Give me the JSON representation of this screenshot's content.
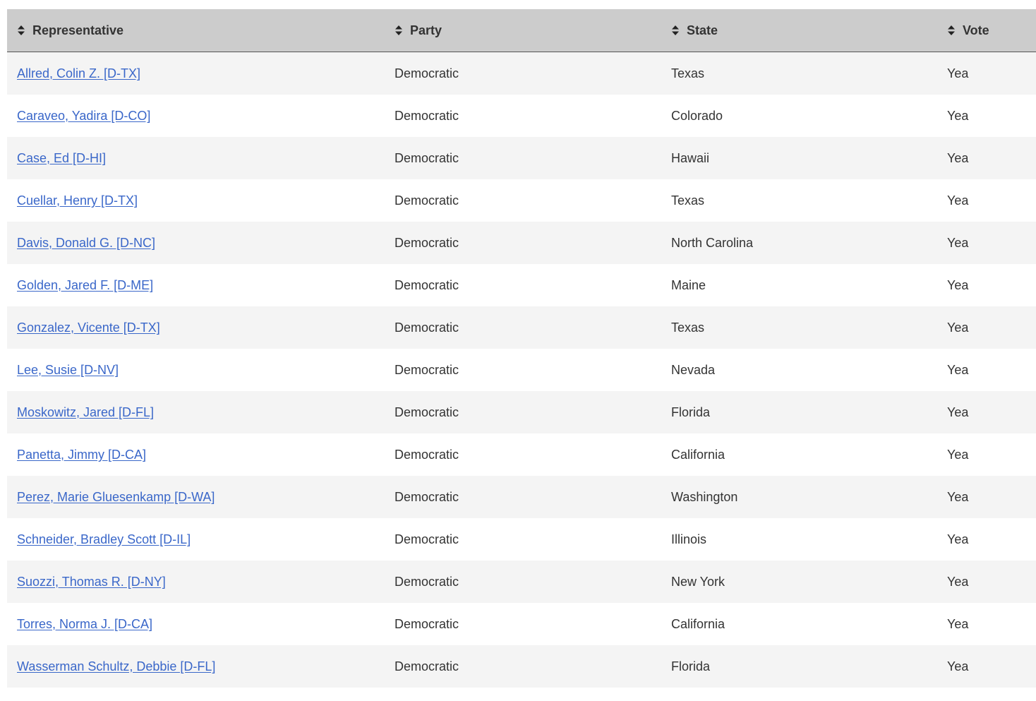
{
  "table": {
    "headers": [
      "Representative",
      "Party",
      "State",
      "Vote"
    ],
    "rows": [
      {
        "representative": "Allred, Colin Z. [D-TX]",
        "party": "Democratic",
        "state": "Texas",
        "vote": "Yea"
      },
      {
        "representative": "Caraveo, Yadira [D-CO]",
        "party": "Democratic",
        "state": "Colorado",
        "vote": "Yea"
      },
      {
        "representative": "Case, Ed [D-HI]",
        "party": "Democratic",
        "state": "Hawaii",
        "vote": "Yea"
      },
      {
        "representative": "Cuellar, Henry [D-TX]",
        "party": "Democratic",
        "state": "Texas",
        "vote": "Yea"
      },
      {
        "representative": "Davis, Donald G. [D-NC]",
        "party": "Democratic",
        "state": "North Carolina",
        "vote": "Yea"
      },
      {
        "representative": "Golden, Jared F. [D-ME]",
        "party": "Democratic",
        "state": "Maine",
        "vote": "Yea"
      },
      {
        "representative": "Gonzalez, Vicente [D-TX]",
        "party": "Democratic",
        "state": "Texas",
        "vote": "Yea"
      },
      {
        "representative": "Lee, Susie [D-NV]",
        "party": "Democratic",
        "state": "Nevada",
        "vote": "Yea"
      },
      {
        "representative": "Moskowitz, Jared [D-FL]",
        "party": "Democratic",
        "state": "Florida",
        "vote": "Yea"
      },
      {
        "representative": "Panetta, Jimmy [D-CA]",
        "party": "Democratic",
        "state": "California",
        "vote": "Yea"
      },
      {
        "representative": "Perez, Marie Gluesenkamp [D-WA]",
        "party": "Democratic",
        "state": "Washington",
        "vote": "Yea"
      },
      {
        "representative": "Schneider, Bradley Scott [D-IL]",
        "party": "Democratic",
        "state": "Illinois",
        "vote": "Yea"
      },
      {
        "representative": "Suozzi, Thomas R. [D-NY]",
        "party": "Democratic",
        "state": "New York",
        "vote": "Yea"
      },
      {
        "representative": "Torres, Norma J. [D-CA]",
        "party": "Democratic",
        "state": "California",
        "vote": "Yea"
      },
      {
        "representative": "Wasserman Schultz, Debbie [D-FL]",
        "party": "Democratic",
        "state": "Florida",
        "vote": "Yea"
      }
    ]
  },
  "icons": {
    "sort": "sort-icon"
  },
  "colors": {
    "header_bg": "#cccccc",
    "link": "#3a67c9",
    "row_stripe": "#f4f4f4",
    "text": "#333333"
  }
}
